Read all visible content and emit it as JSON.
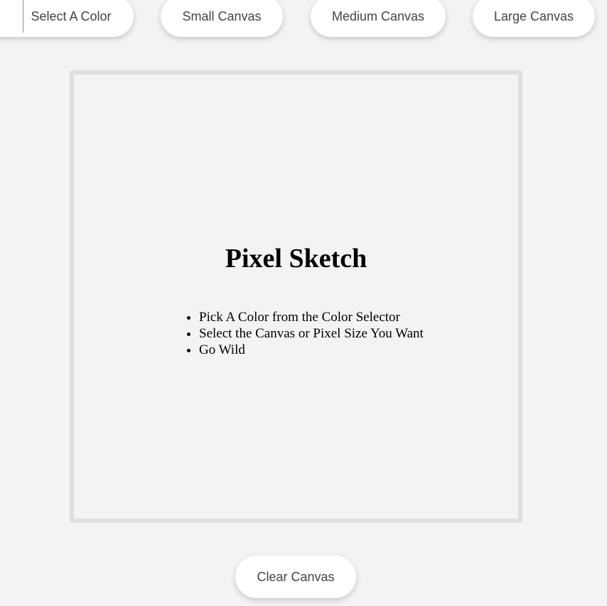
{
  "toolbar": {
    "color_select_label": "Select A Color",
    "small_label": "Small Canvas",
    "medium_label": "Medium Canvas",
    "large_label": "Large Canvas"
  },
  "canvas": {
    "title": "Pixel Sketch",
    "instructions": [
      "Pick A Color from the Color Selector",
      "Select the Canvas or Pixel Size You Want",
      "Go Wild"
    ]
  },
  "footer": {
    "clear_label": "Clear Canvas"
  },
  "colors": {
    "background": "#f3f3f5",
    "button": "#ffffff",
    "button_text": "#444444",
    "canvas_border": "#dedfe2"
  }
}
